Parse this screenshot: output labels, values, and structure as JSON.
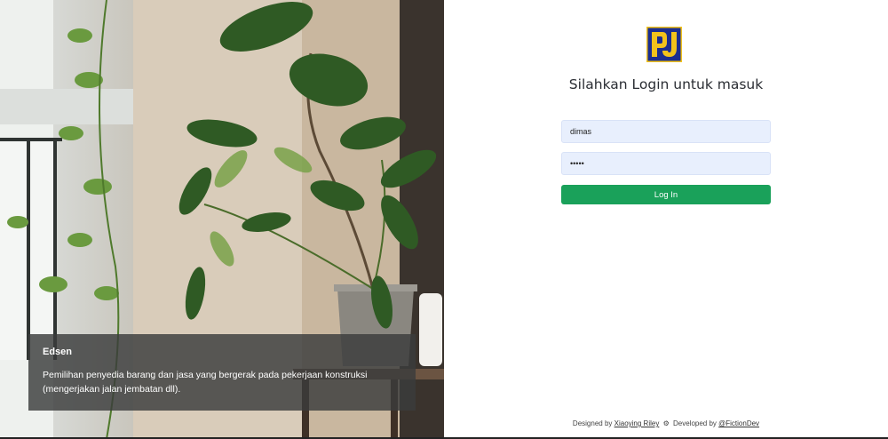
{
  "caption": {
    "title": "Edsen",
    "text": "Pemilihan penyedia barang dan jasa yang bergerak pada pekerjaan konstruksi (mengerjakan jalan jembatan dll)."
  },
  "login": {
    "heading": "Silahkan Login untuk masuk",
    "username_value": "dimas",
    "password_value": "•••••",
    "submit_label": "Log In"
  },
  "footer": {
    "designed_prefix": "Designed by",
    "designer": "Xiaoying Riley",
    "developed_prefix": "Developed by",
    "developer": "@FictionDev"
  },
  "colors": {
    "accent": "#1aa15a",
    "logo_blue": "#1b2d8f",
    "logo_yellow": "#f2c21b"
  }
}
